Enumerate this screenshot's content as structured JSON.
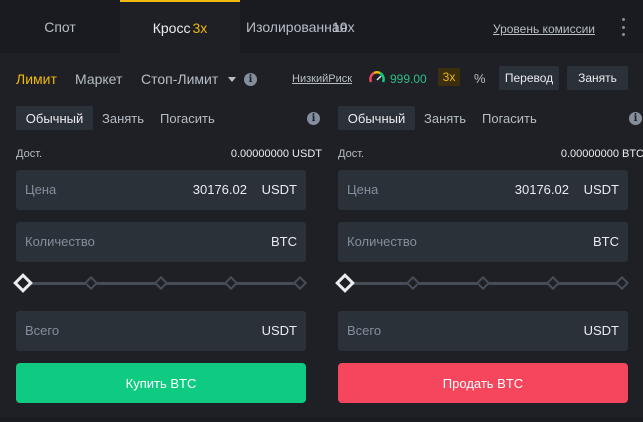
{
  "tabs": {
    "spot": "Спот",
    "cross": "Кросс",
    "cross_leverage": "3x",
    "isolated": "Изолированная",
    "isolated_leverage": "10x",
    "fee_link": "Уровень комиссии"
  },
  "order_types": {
    "limit": "Лимит",
    "market": "Маркет",
    "stop_limit": "Стоп-Лимит"
  },
  "risk": {
    "label": "НизкийРиск",
    "value": "999.00",
    "leverage": "3x"
  },
  "toolbar": {
    "percent_icon": "%",
    "transfer": "Перевод",
    "borrow": "Занять"
  },
  "colors": {
    "accent": "#f0b90b",
    "buy": "#0ecb81",
    "sell": "#f6465d",
    "background": "#1e2026",
    "input_bg": "#2b3139"
  },
  "buy_panel": {
    "modes": [
      "Обычный",
      "Занять",
      "Погасить"
    ],
    "available_label": "Дост.",
    "available_value": "0.00000000 USDT",
    "price_label": "Цена",
    "price_value": "30176.02",
    "price_unit": "USDT",
    "qty_label": "Количество",
    "qty_unit": "BTC",
    "total_label": "Всего",
    "total_unit": "USDT",
    "slider_percent": 0,
    "button": "Купить BTC"
  },
  "sell_panel": {
    "modes": [
      "Обычный",
      "Занять",
      "Погасить"
    ],
    "available_label": "Дост.",
    "available_value": "0.00000000 BTC",
    "price_label": "Цена",
    "price_value": "30176.02",
    "price_unit": "USDT",
    "qty_label": "Количество",
    "qty_unit": "BTC",
    "total_label": "Всего",
    "total_unit": "USDT",
    "slider_percent": 0,
    "button": "Продать BTC"
  }
}
